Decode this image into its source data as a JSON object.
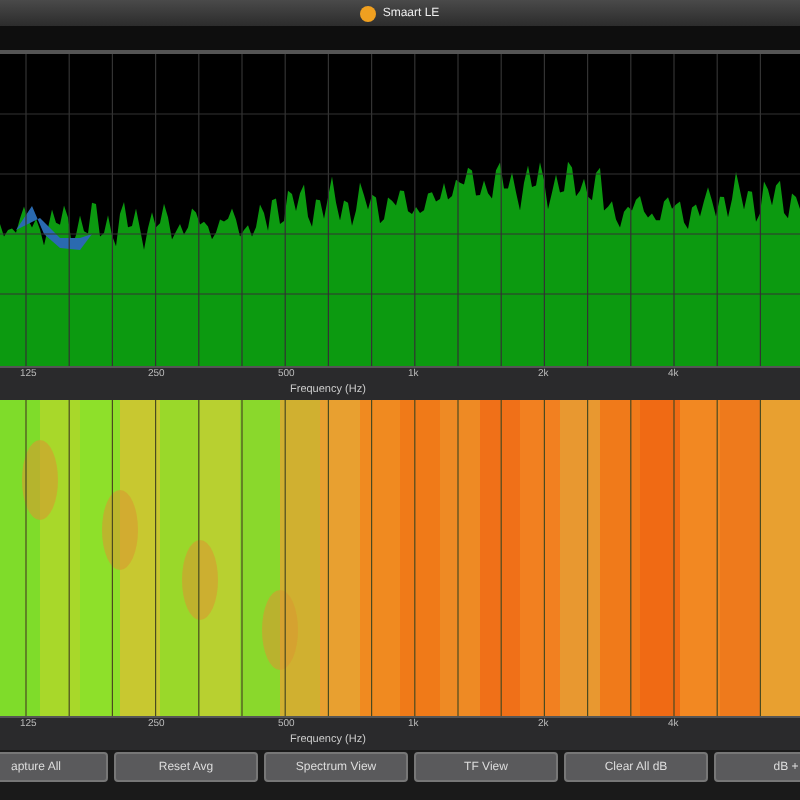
{
  "window": {
    "title": "Smaart LE"
  },
  "spectrum": {
    "axis_ticks": [
      "125",
      "250",
      "500",
      "1k",
      "2k",
      "4k"
    ],
    "axis_label": "Frequency (Hz)"
  },
  "spectrogram": {
    "axis_ticks": [
      "125",
      "250",
      "500",
      "1k",
      "2k",
      "4k"
    ],
    "axis_label": "Frequency (Hz)"
  },
  "buttons": [
    {
      "label": "apture All"
    },
    {
      "label": "Reset Avg"
    },
    {
      "label": "Spectrum View"
    },
    {
      "label": "TF View"
    },
    {
      "label": "Clear All dB"
    },
    {
      "label": "dB +"
    }
  ]
}
